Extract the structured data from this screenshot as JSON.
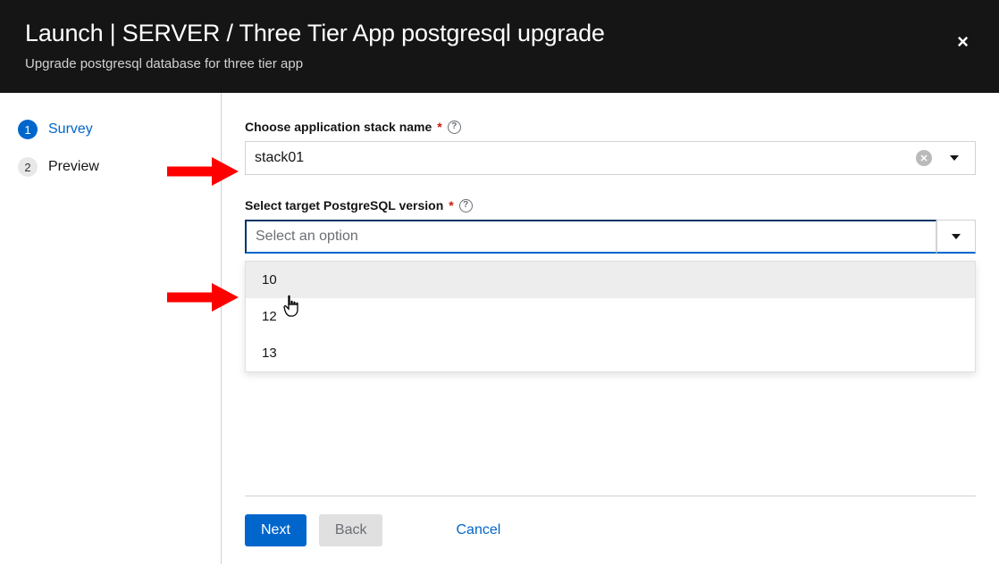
{
  "header": {
    "title": "Launch | SERVER / Three Tier App postgresql upgrade",
    "subtitle": "Upgrade postgresql database for three tier app",
    "close_label": "×"
  },
  "sidebar": {
    "steps": [
      {
        "num": "1",
        "label": "Survey",
        "active": true
      },
      {
        "num": "2",
        "label": "Preview",
        "active": false
      }
    ]
  },
  "form": {
    "stack": {
      "label": "Choose application stack name",
      "value": "stack01"
    },
    "version": {
      "label": "Select target PostgreSQL version",
      "placeholder": "Select an option",
      "options": [
        "10",
        "12",
        "13"
      ],
      "highlighted_index": 0
    }
  },
  "footer": {
    "next": "Next",
    "back": "Back",
    "cancel": "Cancel"
  }
}
